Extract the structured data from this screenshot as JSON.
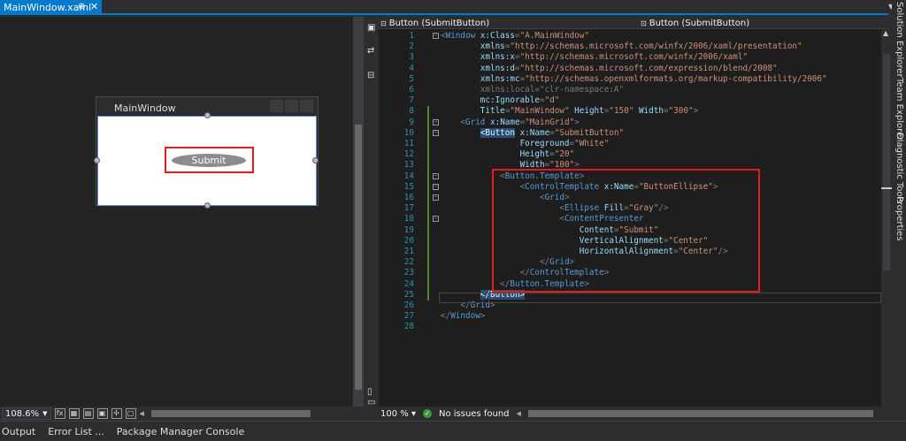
{
  "doc_tab": {
    "title": "MainWindow.xaml",
    "pin": "⊕",
    "close": "✕"
  },
  "designer": {
    "window_title": "MainWindow",
    "button_text": "Submit",
    "zoom": "108.6%",
    "fx_label": "fx"
  },
  "navbar": {
    "left": "Button (SubmitButton)",
    "right": "Button (SubmitButton)"
  },
  "editor": {
    "zoom": "100 %",
    "status": "No issues found",
    "lines": [
      [
        [
          "t-br",
          "<"
        ],
        [
          "t-tag",
          "Window "
        ],
        [
          "t-attr",
          "x:Class"
        ],
        [
          "t-br",
          "="
        ],
        [
          "t-val",
          "\"A.MainWindow\""
        ]
      ],
      [
        [
          "t-txt",
          "        "
        ],
        [
          "t-attr",
          "xmlns"
        ],
        [
          "t-br",
          "="
        ],
        [
          "t-val",
          "\"http://schemas.microsoft.com/winfx/2006/xaml/presentation\""
        ]
      ],
      [
        [
          "t-txt",
          "        "
        ],
        [
          "t-attr",
          "xmlns:x"
        ],
        [
          "t-br",
          "="
        ],
        [
          "t-val",
          "\"http://schemas.microsoft.com/winfx/2006/xaml\""
        ]
      ],
      [
        [
          "t-txt",
          "        "
        ],
        [
          "t-attr",
          "xmlns:d"
        ],
        [
          "t-br",
          "="
        ],
        [
          "t-val",
          "\"http://schemas.microsoft.com/expression/blend/2008\""
        ]
      ],
      [
        [
          "t-txt",
          "        "
        ],
        [
          "t-attr",
          "xmlns:mc"
        ],
        [
          "t-br",
          "="
        ],
        [
          "t-val",
          "\"http://schemas.openxmlformats.org/markup-compatibility/2006\""
        ]
      ],
      [
        [
          "t-txt",
          "        "
        ],
        [
          "t-dim",
          "xmlns:local=\"clr-namespace:A\""
        ]
      ],
      [
        [
          "t-txt",
          "        "
        ],
        [
          "t-attr",
          "mc:Ignorable"
        ],
        [
          "t-br",
          "="
        ],
        [
          "t-val",
          "\"d\""
        ]
      ],
      [
        [
          "t-txt",
          "        "
        ],
        [
          "t-attr",
          "Title"
        ],
        [
          "t-br",
          "="
        ],
        [
          "t-val",
          "\"MainWindow\" "
        ],
        [
          "t-attr",
          "Height"
        ],
        [
          "t-br",
          "="
        ],
        [
          "t-val",
          "\"150\" "
        ],
        [
          "t-attr",
          "Width"
        ],
        [
          "t-br",
          "="
        ],
        [
          "t-val",
          "\"300\""
        ],
        [
          "t-br",
          ">"
        ]
      ],
      [
        [
          "t-txt",
          "    "
        ],
        [
          "t-br",
          "<"
        ],
        [
          "t-tag",
          "Grid "
        ],
        [
          "t-attr",
          "x:Name"
        ],
        [
          "t-br",
          "="
        ],
        [
          "t-val",
          "\"MainGrid\""
        ],
        [
          "t-br",
          ">"
        ]
      ],
      [
        [
          "t-txt",
          "        "
        ],
        [
          "hl",
          "<Button"
        ],
        [
          "t-txt",
          " "
        ],
        [
          "t-attr",
          "x:Name"
        ],
        [
          "t-br",
          "="
        ],
        [
          "t-val",
          "\"SubmitButton\""
        ]
      ],
      [
        [
          "t-txt",
          "                "
        ],
        [
          "t-attr",
          "Foreground"
        ],
        [
          "t-br",
          "="
        ],
        [
          "t-val",
          "\"White\""
        ]
      ],
      [
        [
          "t-txt",
          "                "
        ],
        [
          "t-attr",
          "Height"
        ],
        [
          "t-br",
          "="
        ],
        [
          "t-val",
          "\"20\""
        ]
      ],
      [
        [
          "t-txt",
          "                "
        ],
        [
          "t-attr",
          "Width"
        ],
        [
          "t-br",
          "="
        ],
        [
          "t-val",
          "\"100\""
        ],
        [
          "t-br",
          ">"
        ]
      ],
      [
        [
          "t-txt",
          "            "
        ],
        [
          "t-br",
          "<"
        ],
        [
          "t-tag",
          "Button.Template"
        ],
        [
          "t-br",
          ">"
        ]
      ],
      [
        [
          "t-txt",
          "                "
        ],
        [
          "t-br",
          "<"
        ],
        [
          "t-tag",
          "ControlTemplate "
        ],
        [
          "t-attr",
          "x:Name"
        ],
        [
          "t-br",
          "="
        ],
        [
          "t-val",
          "\"ButtonEllipse\""
        ],
        [
          "t-br",
          ">"
        ]
      ],
      [
        [
          "t-txt",
          "                    "
        ],
        [
          "t-br",
          "<"
        ],
        [
          "t-tag",
          "Grid"
        ],
        [
          "t-br",
          ">"
        ]
      ],
      [
        [
          "t-txt",
          "                        "
        ],
        [
          "t-br",
          "<"
        ],
        [
          "t-tag",
          "Ellipse "
        ],
        [
          "t-attr",
          "Fill"
        ],
        [
          "t-br",
          "="
        ],
        [
          "t-val",
          "\"Gray\""
        ],
        [
          "t-br",
          "/>"
        ]
      ],
      [
        [
          "t-txt",
          "                        "
        ],
        [
          "t-br",
          "<"
        ],
        [
          "t-tag",
          "ContentPresenter"
        ]
      ],
      [
        [
          "t-txt",
          "                            "
        ],
        [
          "t-attr",
          "Content"
        ],
        [
          "t-br",
          "="
        ],
        [
          "t-val",
          "\"Submit\""
        ]
      ],
      [
        [
          "t-txt",
          "                            "
        ],
        [
          "t-attr",
          "VerticalAlignment"
        ],
        [
          "t-br",
          "="
        ],
        [
          "t-val",
          "\"Center\""
        ]
      ],
      [
        [
          "t-txt",
          "                            "
        ],
        [
          "t-attr",
          "HorizontalAlignment"
        ],
        [
          "t-br",
          "="
        ],
        [
          "t-val",
          "\"Center\""
        ],
        [
          "t-br",
          "/>"
        ]
      ],
      [
        [
          "t-txt",
          "                    "
        ],
        [
          "t-br",
          "</"
        ],
        [
          "t-tag",
          "Grid"
        ],
        [
          "t-br",
          ">"
        ]
      ],
      [
        [
          "t-txt",
          "                "
        ],
        [
          "t-br",
          "</"
        ],
        [
          "t-tag",
          "ControlTemplate"
        ],
        [
          "t-br",
          ">"
        ]
      ],
      [
        [
          "t-txt",
          "            "
        ],
        [
          "t-br",
          "</"
        ],
        [
          "t-tag",
          "Button.Template"
        ],
        [
          "t-br",
          ">"
        ]
      ],
      [
        [
          "t-txt",
          "        "
        ],
        [
          "hl",
          "</Button>"
        ]
      ],
      [
        [
          "t-txt",
          "    "
        ],
        [
          "t-br",
          "</"
        ],
        [
          "t-tag",
          "Grid"
        ],
        [
          "t-br",
          ">"
        ]
      ],
      [
        [
          "t-br",
          "</"
        ],
        [
          "t-tag",
          "Window"
        ],
        [
          "t-br",
          ">"
        ]
      ],
      []
    ]
  },
  "right_tabs": [
    "Solution Explorer",
    "Team Explorer",
    "Diagnostic Tools",
    "Properties"
  ],
  "status_tabs": [
    "Output",
    "Error List ...",
    "Package Manager Console"
  ]
}
